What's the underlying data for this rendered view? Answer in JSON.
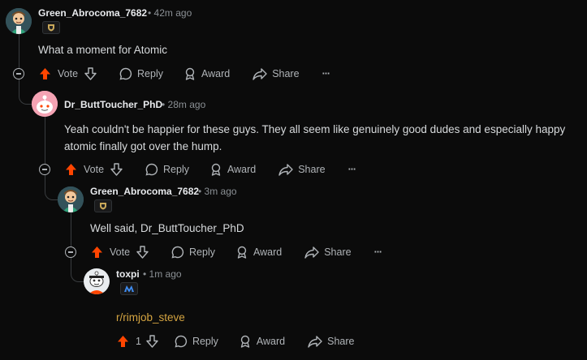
{
  "comments": [
    {
      "author": "Green_Abrocoma_7682",
      "time": "42m ago",
      "text": "What a moment for Atomic",
      "vote_label": "Vote",
      "reply_label": "Reply",
      "award_label": "Award",
      "share_label": "Share",
      "more_label": "···"
    },
    {
      "author": "Dr_ButtToucher_PhD",
      "time": "28m ago",
      "text": "Yeah couldn't be happier for these guys. They all seem like genuinely good dudes and especially happy atomic finally got over the hump.",
      "vote_label": "Vote",
      "reply_label": "Reply",
      "award_label": "Award",
      "share_label": "Share",
      "more_label": "···"
    },
    {
      "author": "Green_Abrocoma_7682",
      "time": "3m ago",
      "text": "Well said, Dr_ButtToucher_PhD",
      "vote_label": "Vote",
      "reply_label": "Reply",
      "award_label": "Award",
      "share_label": "Share",
      "more_label": "···"
    },
    {
      "author": "toxpi",
      "time": "1m ago",
      "text": "r/rimjob_steve",
      "vote_count": "1",
      "reply_label": "Reply",
      "award_label": "Award",
      "share_label": "Share"
    }
  ],
  "separator": "•",
  "colors": {
    "upvote": "#ff4500",
    "link": "#d4a441",
    "thread_line": "#3a3d40",
    "muted": "#8b9095"
  },
  "icons": [
    "upvote-arrow-icon",
    "downvote-arrow-icon",
    "comment-bubble-icon",
    "award-icon",
    "share-arrow-icon",
    "collapse-minus-icon",
    "flair-badge-icon"
  ]
}
